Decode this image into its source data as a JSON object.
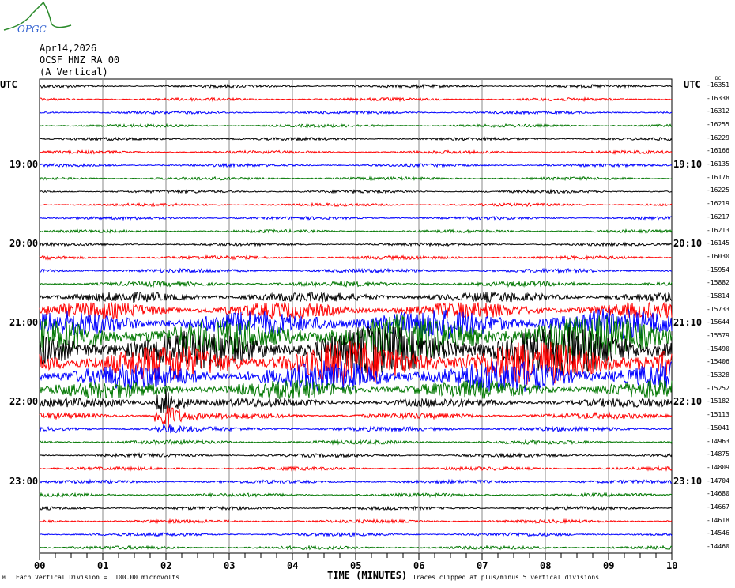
{
  "logo": {
    "text": "OPGC"
  },
  "header": {
    "date": "Apr14,2026",
    "station": "OCSF HNZ RA 00",
    "component": "(A Vertical)"
  },
  "chart_data": {
    "type": "line",
    "title": "Apr14,2026 OCSF HNZ RA 00 (A Vertical)",
    "xlabel": "TIME (MINUTES)",
    "xlim": [
      0,
      10
    ],
    "x_ticks": [
      "00",
      "01",
      "02",
      "03",
      "04",
      "05",
      "06",
      "07",
      "08",
      "09",
      "10"
    ],
    "left_axis_title": "UTC",
    "right_axis_title": "UTC",
    "dc_title": "DC",
    "left_hour_labels": [
      {
        "trace": 6,
        "label": "19:00"
      },
      {
        "trace": 12,
        "label": "20:00"
      },
      {
        "trace": 18,
        "label": "21:00"
      },
      {
        "trace": 24,
        "label": "22:00"
      },
      {
        "trace": 30,
        "label": "23:00"
      }
    ],
    "right_hour_labels": [
      {
        "trace": 6,
        "label": "19:10"
      },
      {
        "trace": 12,
        "label": "20:10"
      },
      {
        "trace": 18,
        "label": "21:10"
      },
      {
        "trace": 24,
        "label": "22:10"
      },
      {
        "trace": 30,
        "label": "23:10"
      }
    ],
    "trace_colors": [
      "#000000",
      "#ff0000",
      "#0000ff",
      "#007700"
    ],
    "dc_offsets": [
      "-16351",
      "-16338",
      "-16312",
      "-16255",
      "-16229",
      "-16166",
      "-16135",
      "-16176",
      "-16225",
      "-16219",
      "-16217",
      "-16213",
      "-16145",
      "-16030",
      "-15954",
      "-15882",
      "-15814",
      "-15733",
      "-15644",
      "-15579",
      "-15490",
      "-15406",
      "-15328",
      "-15252",
      "-15182",
      "-15113",
      "-15041",
      "-14963",
      "-14875",
      "-14809",
      "-14704",
      "-14680",
      "-14667",
      "-14618",
      "-14546",
      "-14460"
    ],
    "trace_amplitude_divisions": [
      0.15,
      0.15,
      0.15,
      0.15,
      0.15,
      0.15,
      0.15,
      0.15,
      0.15,
      0.15,
      0.15,
      0.15,
      0.15,
      0.18,
      0.2,
      0.25,
      0.5,
      0.8,
      1.5,
      2.2,
      2.4,
      2.2,
      1.6,
      0.9,
      0.45,
      0.3,
      0.22,
      0.2,
      0.18,
      0.17,
      0.17,
      0.17,
      0.17,
      0.17,
      0.17,
      0.17
    ],
    "event": {
      "minute": 2.0,
      "traces": [
        24,
        25,
        26
      ],
      "amplitude_divisions": [
        2.0,
        2.0,
        0.6
      ]
    },
    "footer_scale": "Each Vertical Division =  100.00 microvolts",
    "footer_clip": "Traces clipped at plus/minus 5 vertical divisions",
    "footer_mark": "M"
  }
}
